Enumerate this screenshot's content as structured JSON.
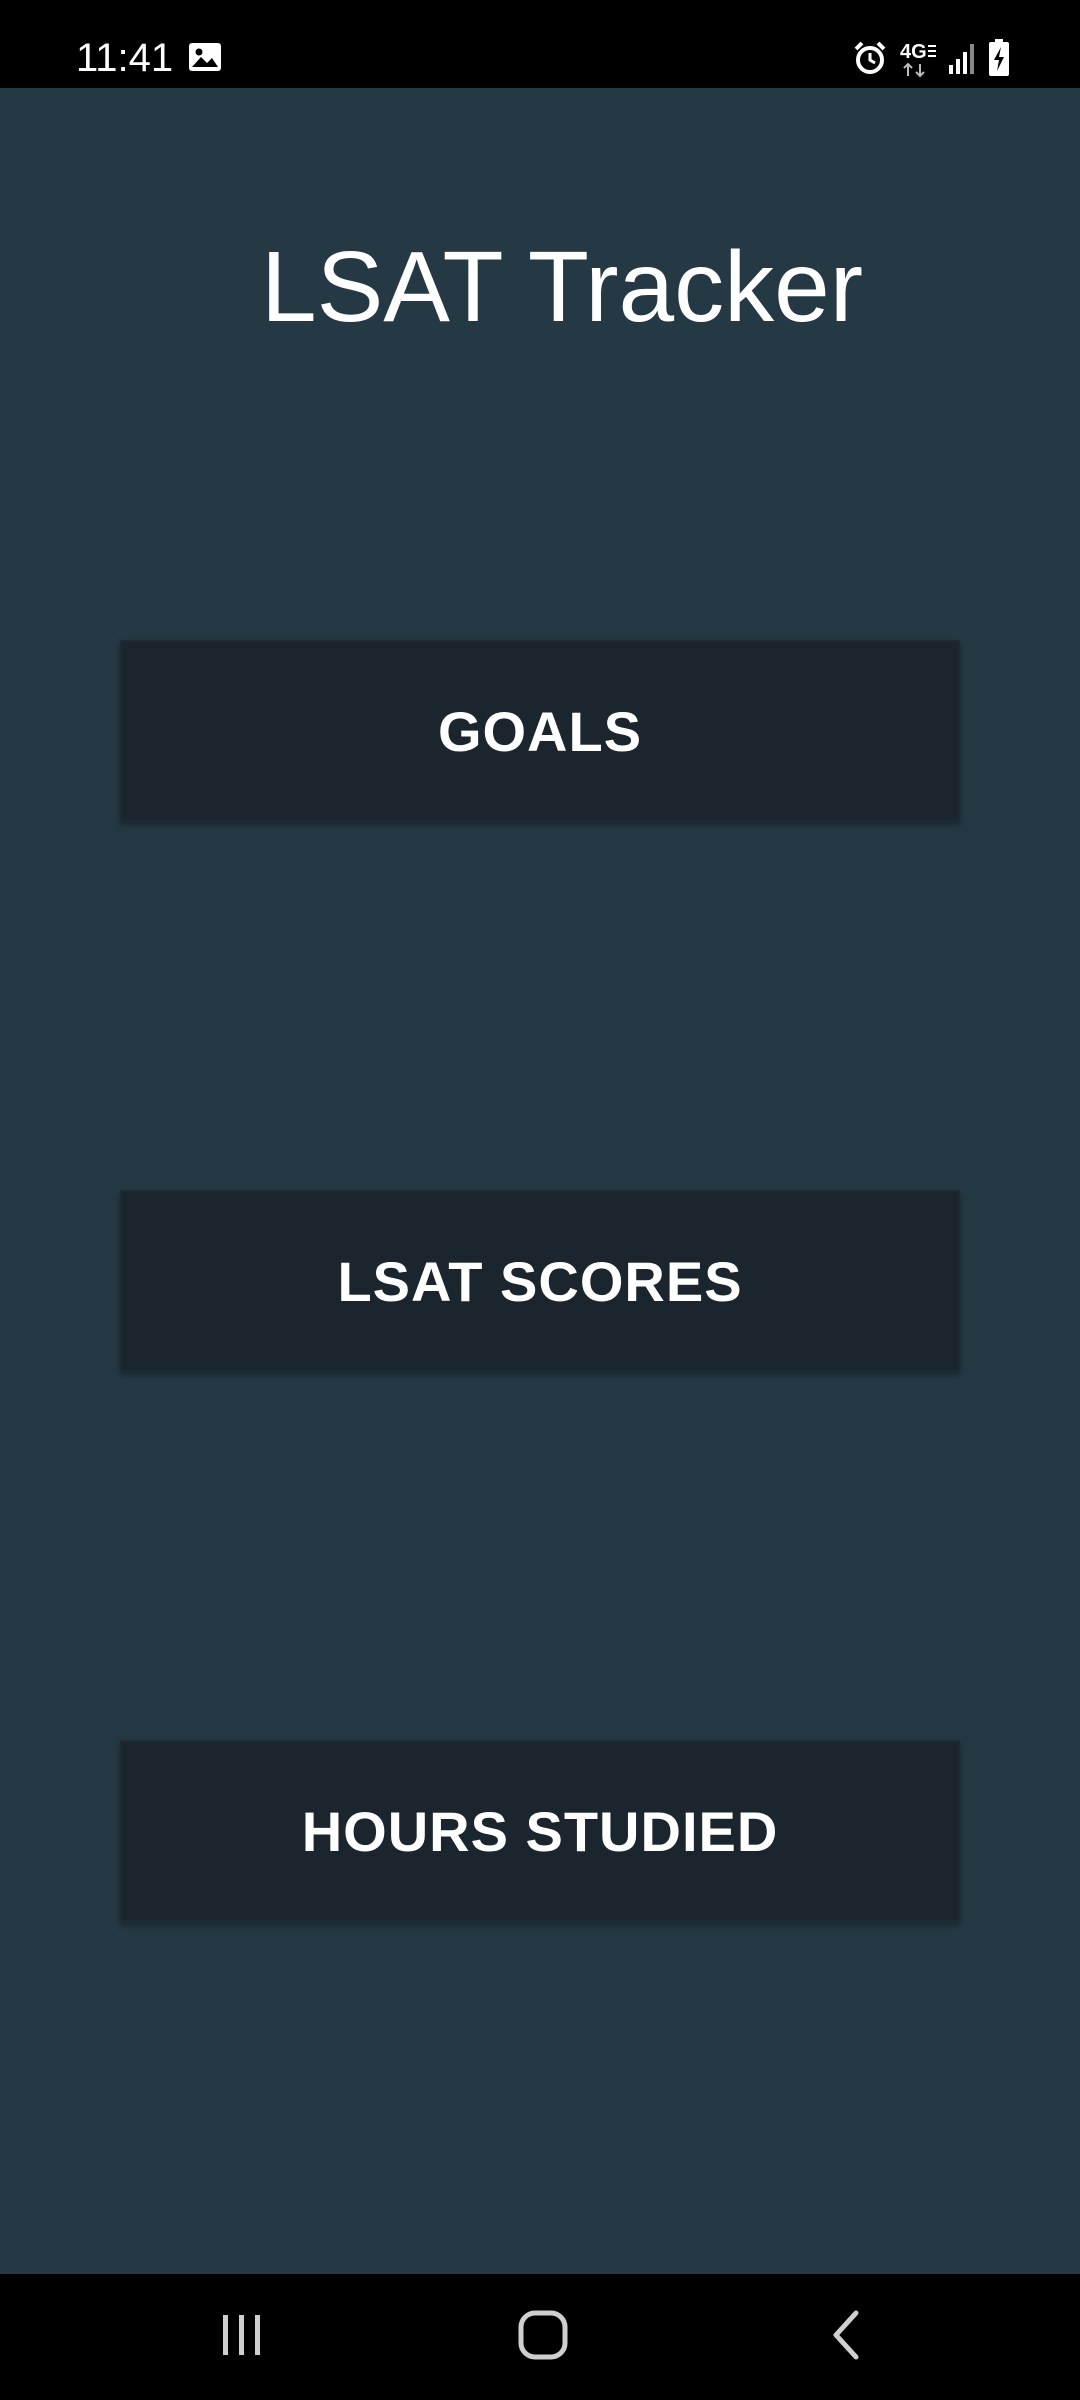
{
  "status_bar": {
    "time": "11:41",
    "icons": [
      "gallery-icon",
      "alarm-icon",
      "4g-lte-icon",
      "signal-icon",
      "battery-charging-icon"
    ],
    "network_label": "4G"
  },
  "app": {
    "title": "LSAT Tracker"
  },
  "menu": {
    "goals_label": "GOALS",
    "scores_label": "LSAT SCORES",
    "hours_label": "HOURS STUDIED"
  },
  "nav_bar": {
    "icons": [
      "recents-icon",
      "home-icon",
      "back-icon"
    ]
  },
  "colors": {
    "background": "#253945",
    "button": "#1b252d",
    "text": "#ffffff",
    "system_bars": "#000000"
  }
}
